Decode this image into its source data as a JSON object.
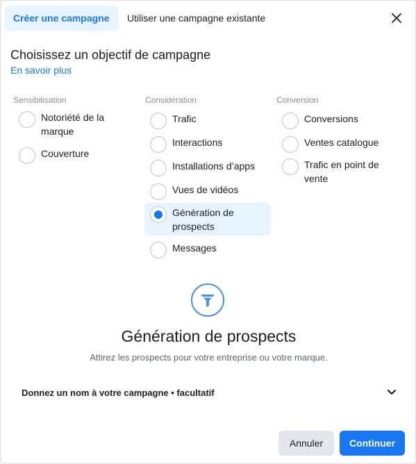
{
  "tabs": {
    "active": "Créer une campagne",
    "inactive": "Utiliser une campagne existante"
  },
  "close_icon": "close-icon",
  "heading": "Choisissez un objectif de campagne",
  "learn_more": "En savoir plus",
  "columns": {
    "awareness": {
      "title": "Sensibilisation",
      "options": [
        "Notoriété de la marque",
        "Couverture"
      ]
    },
    "consideration": {
      "title": "Considération",
      "options": [
        "Trafic",
        "Interactions",
        "Installations d’apps",
        "Vues de vidéos",
        "Génération de prospects",
        "Messages"
      ]
    },
    "conversion": {
      "title": "Conversion",
      "options": [
        "Conversions",
        "Ventes catalogue",
        "Trafic en point de vente"
      ]
    }
  },
  "selected_option": "Génération de prospects",
  "detail": {
    "icon": "funnel-icon",
    "title": "Génération de prospects",
    "description": "Attirez les prospects pour votre entreprise ou votre marque."
  },
  "campaign_name": {
    "label": "Donnez un nom à votre campagne • facultatif",
    "icon": "chevron-down-icon"
  },
  "footer": {
    "cancel": "Annuler",
    "continue": "Continuer"
  },
  "colors": {
    "accent": "#1877f2",
    "accent_light": "#e7f3ff",
    "funnel": "#4a90e2"
  }
}
